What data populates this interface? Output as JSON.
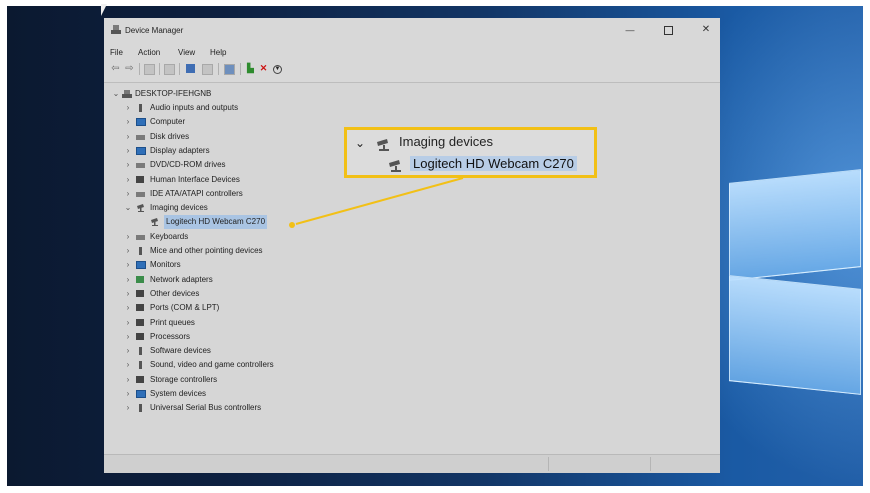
{
  "window": {
    "title": "Device Manager",
    "controls": {
      "minimize": "—",
      "close": "✕"
    }
  },
  "menu": [
    "File",
    "Action",
    "View",
    "Help"
  ],
  "tree": {
    "root": "DESKTOP-IFEHGNB",
    "items": [
      {
        "label": "Audio inputs and outputs",
        "icon": "speaker-icon"
      },
      {
        "label": "Computer",
        "icon": "monitor-icon"
      },
      {
        "label": "Disk drives",
        "icon": "disk-drive-icon"
      },
      {
        "label": "Display adapters",
        "icon": "display-adapter-icon"
      },
      {
        "label": "DVD/CD-ROM drives",
        "icon": "dvd-drive-icon"
      },
      {
        "label": "Human Interface Devices",
        "icon": "hid-icon"
      },
      {
        "label": "IDE ATA/ATAPI controllers",
        "icon": "ide-controller-icon"
      },
      {
        "label": "Imaging devices",
        "icon": "camera-icon",
        "expanded": true,
        "children": [
          {
            "label": "Logitech HD Webcam C270",
            "icon": "camera-icon",
            "selected": true
          }
        ]
      },
      {
        "label": "Keyboards",
        "icon": "keyboard-icon"
      },
      {
        "label": "Mice and other pointing devices",
        "icon": "mouse-icon"
      },
      {
        "label": "Monitors",
        "icon": "monitor-icon"
      },
      {
        "label": "Network adapters",
        "icon": "network-icon"
      },
      {
        "label": "Other devices",
        "icon": "unknown-device-icon"
      },
      {
        "label": "Ports (COM & LPT)",
        "icon": "port-icon"
      },
      {
        "label": "Print queues",
        "icon": "printer-icon"
      },
      {
        "label": "Processors",
        "icon": "processor-icon"
      },
      {
        "label": "Software devices",
        "icon": "software-device-icon"
      },
      {
        "label": "Sound, video and game controllers",
        "icon": "speaker-icon"
      },
      {
        "label": "Storage controllers",
        "icon": "storage-icon"
      },
      {
        "label": "System devices",
        "icon": "system-device-icon"
      },
      {
        "label": "Universal Serial Bus controllers",
        "icon": "usb-icon"
      }
    ]
  },
  "callout": {
    "parent": "Imaging devices",
    "child": "Logitech HD Webcam C270"
  },
  "colors": {
    "highlight": "#f2c016",
    "selection": "#a9c4e3",
    "desktop": "#123565"
  }
}
